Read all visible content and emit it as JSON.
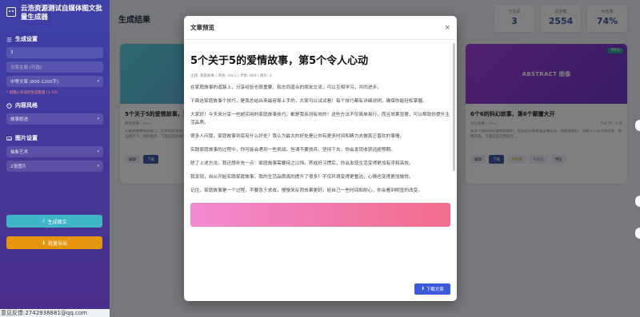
{
  "app": {
    "title": "云浩资源测试自媒体图文批量生成器"
  },
  "sidebar": {
    "gen_settings": "生成设置",
    "count_value": "3",
    "topic_placeholder": "文章主题 (可选)",
    "length_value": "中等文章 (800-1200字)",
    "warning": "* 请输入有效的生成数量 (1-10)",
    "content_style": "内容风格",
    "style_value": "故事叙述",
    "image_settings": "图片设置",
    "image_style_value": "抽象艺术",
    "image_count_value": "2张图片",
    "generate_label": "生成图文",
    "export_label": "批量导出",
    "footer": "意见反馈:2742938881@qq.com"
  },
  "main": {
    "title": "生成结果",
    "stats": [
      {
        "label": "已生成",
        "value": "3"
      },
      {
        "label": "总字数",
        "value": "2554"
      },
      {
        "label": "AI含量",
        "value": "74%"
      }
    ],
    "cards": [
      {
        "title": "5个关于5的爱情故事，第5个令人心动",
        "meta_left": "家庭故事 · story",
        "meta_right": "",
        "body": "在家庭故事的道路上，分享经验也很重要，和志同道合的朋友交流，可以互相学习，共同进步。下面这家庭故事个技巧...",
        "img_label": "",
        "badge": "",
        "actions": [
          "编辑",
          "下载"
        ]
      },
      {
        "title": "6个6的科幻故事，第6个颠覆大开",
        "meta_left": "科幻故事 · story",
        "meta_right": "746 字 · 2 图",
        "body": "很多人觉得科幻题材很复杂，但其实只要掌握正确方法，就能很轻松。热爱在于从小到大多，确保实践，下面这些实用技巧...",
        "img_label": "ABSTRACT 图像",
        "badge": "75%",
        "actions": [
          "编辑",
          "下载",
          "AI检测",
          "AI优化",
          "预览"
        ]
      }
    ]
  },
  "modal": {
    "header": "文章预览",
    "close": "×",
    "article_title": "5个关于5的爱情故事，第5个令人心动",
    "meta": "主题: 家庭故事 | 风格: story | 字数: 869 | 图片: 2",
    "paragraphs": [
      "在家庭故事的道路上，分享经验也很重要，和志同道合的朋友交流，可以互相学习，共同进步。",
      "下面这家庭故事个技巧，是我总结出来最容易上手的，大家可以试试看！每个技巧都有详细说明，确保你能轻松掌握。",
      "大家好！今天来分享一些超实用的家庭故事技巧，都是我亲测有效的！这些方法不仅简单易行，而且效果显著，可以帮助你提升生活品质。",
      "很多人问我，家庭故事到底有什么好处？我认为最大的好处是让你有更多时间和精力去做真正喜欢的事情。",
      "实践家庭故事的过程中，你可能会遇到一些挑战，但请不要放弃。坚持下去，你会发现收获远超预期。",
      "除了上述方法，我还想补充一点：家庭故事需要持之以恒。养成好习惯后，你会发现生活变得更加有序和高效。",
      "我发现，自从开始实践家庭故事，我的生活品质真的提升了很多！不仅环境变得更整洁，心情也变得更加愉悦。",
      "记住，家庭故事是一个过程，不要急于求成，慢慢来反而效果更好。给自己一些时间和耐心，你会看到明显的改变。"
    ],
    "download_label": "下载文章"
  }
}
